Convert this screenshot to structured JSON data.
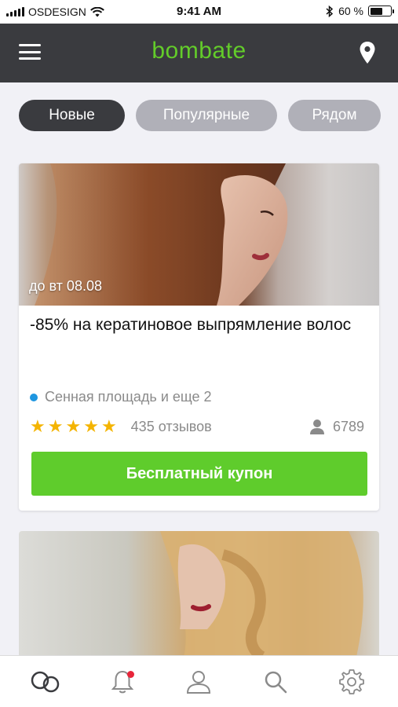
{
  "status_bar": {
    "carrier": "OSDESIGN",
    "time": "9:41 AM",
    "battery_percent": "60 %",
    "battery_level": 0.6
  },
  "header": {
    "logo": "bombate",
    "menu_icon": "hamburger-menu-icon",
    "location_icon": "map-pin-icon"
  },
  "tabs": [
    {
      "label": "Новые",
      "active": true
    },
    {
      "label": "Популярные",
      "active": false
    },
    {
      "label": "Рядом",
      "active": false
    }
  ],
  "offer": {
    "date_badge": "до вт 08.08",
    "title": "-85% на кератиновое выпрямление волос",
    "location": "Сенная площадь и еще 2",
    "rating_stars": 5,
    "reviews": "435 отзывов",
    "buyers": "6789",
    "button_label": "Бесплатный купон"
  },
  "tab_bar": [
    {
      "icon": "boombate-home-icon",
      "active": true
    },
    {
      "icon": "bell-icon",
      "badge": true
    },
    {
      "icon": "profile-icon"
    },
    {
      "icon": "search-icon"
    },
    {
      "icon": "settings-gear-icon"
    }
  ],
  "colors": {
    "header_bg": "#3a3b3f",
    "brand_green": "#63cc2a",
    "button_green": "#5fcc2c",
    "tab_inactive": "#b0b0b8",
    "star": "#f4b400",
    "location_dot": "#1e96e0",
    "notification_dot": "#e8253a"
  }
}
